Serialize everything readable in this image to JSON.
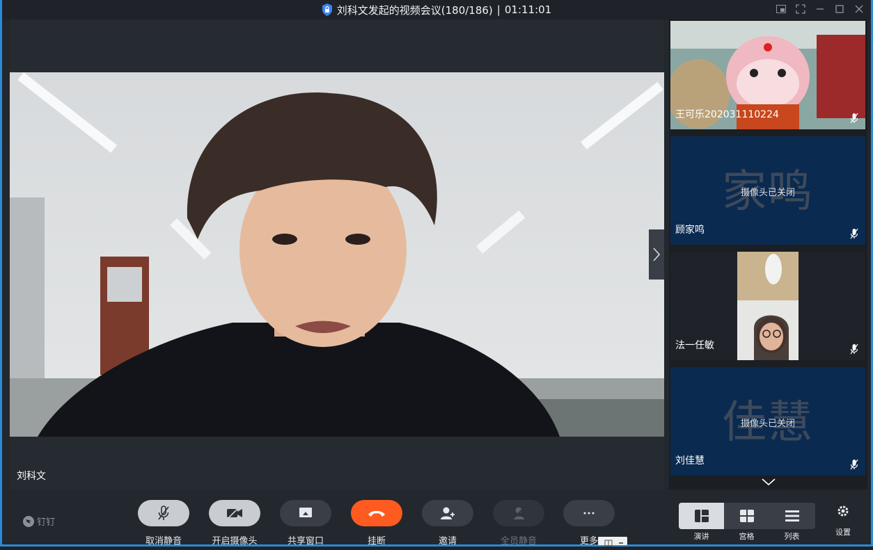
{
  "window": {
    "title": "刘科文发起的视频会议(180/186)",
    "separator": "|",
    "elapsed": "01:11:01"
  },
  "main_stage": {
    "speaker_name": "刘科文"
  },
  "participants": [
    {
      "name": "王可乐202031110224",
      "camera": "on"
    },
    {
      "name": "顾家鸣",
      "camera": "off",
      "avatar_text": "家鸣",
      "camera_off_text": "摄像头已关闭"
    },
    {
      "name": "法一任敏",
      "camera": "on"
    },
    {
      "name": "刘佳慧",
      "camera": "off",
      "avatar_text": "佳慧",
      "camera_off_text": "摄像头已关闭"
    }
  ],
  "toolbar": {
    "brand": "钉钉",
    "unmute": "取消静音",
    "camera_on": "开启摄像头",
    "share": "共享窗口",
    "hangup": "挂断",
    "invite": "邀请",
    "mute_all": "全员静音",
    "more": "更多",
    "layouts": [
      "演讲",
      "宫格",
      "列表"
    ],
    "settings": "设置"
  },
  "colors": {
    "accent_border": "#2a8bd8",
    "hangup": "#ff5a1f",
    "camera_off_bg": "#0b2a4f"
  }
}
